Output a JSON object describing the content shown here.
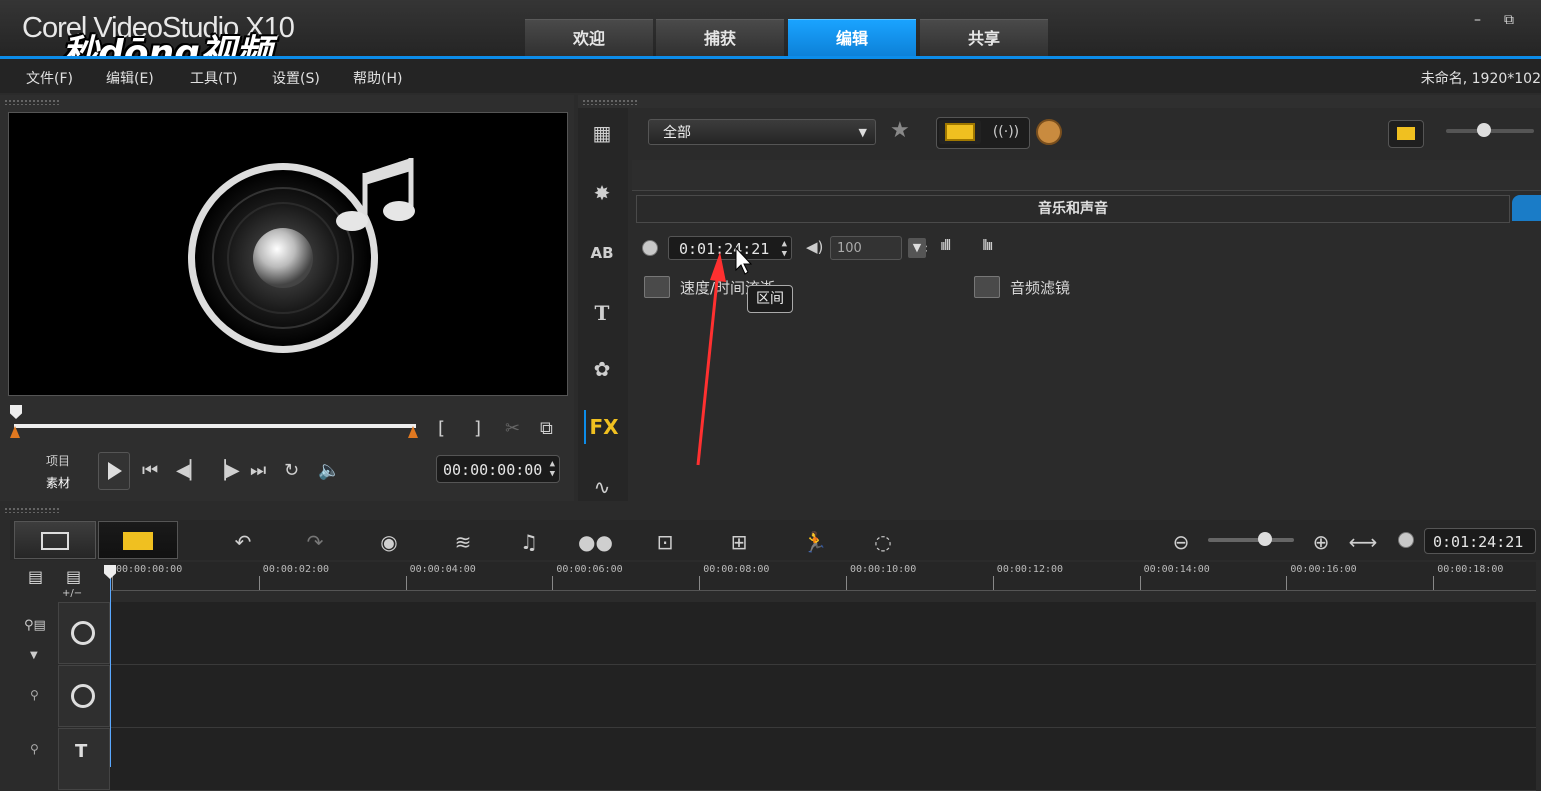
{
  "app": {
    "title": "Corel VideoStudio X10",
    "watermark": "秒dōng视频"
  },
  "top_tabs": [
    {
      "label": "欢迎",
      "active": false
    },
    {
      "label": "捕获",
      "active": false
    },
    {
      "label": "编辑",
      "active": true
    },
    {
      "label": "共享",
      "active": false
    }
  ],
  "window_controls": {
    "minimize": "–",
    "restore": "⧉"
  },
  "menu": [
    "文件(F)",
    "编辑(E)",
    "工具(T)",
    "设置(S)",
    "帮助(H)"
  ],
  "project_info": "未命名, 1920*102",
  "library": {
    "dropdown_value": "全部",
    "panel_title": "音乐和声音",
    "duration": "0:01:24:21",
    "volume": "100",
    "options": [
      {
        "label": "速度/时间流逝",
        "icon": "speed-icon"
      },
      {
        "label": "音频滤镜",
        "icon": "audio-filter-icon"
      }
    ],
    "tooltip": "区间",
    "side_tools": [
      "media-icon",
      "instant-project-icon",
      "transition-icon",
      "title-icon",
      "graphic-icon",
      "filter-icon",
      "path-icon"
    ],
    "fx_label": "FX"
  },
  "player": {
    "mode_labels": [
      "项目",
      "素材"
    ],
    "timecode": "00:00:00:00"
  },
  "timeline": {
    "duration": "0:01:24:21",
    "ticks": [
      "00:00:00:00",
      "00:00:02:00",
      "00:00:04:00",
      "00:00:06:00",
      "00:00:08:00",
      "00:00:10:00",
      "00:00:12:00",
      "00:00:14:00",
      "00:00:16:00",
      "00:00:18:00"
    ],
    "add_remove": "+/−",
    "title_track_label": "T"
  },
  "colors": {
    "accent": "#0c8ce9",
    "highlight": "#f0c020",
    "annotation": "#ff3030"
  }
}
